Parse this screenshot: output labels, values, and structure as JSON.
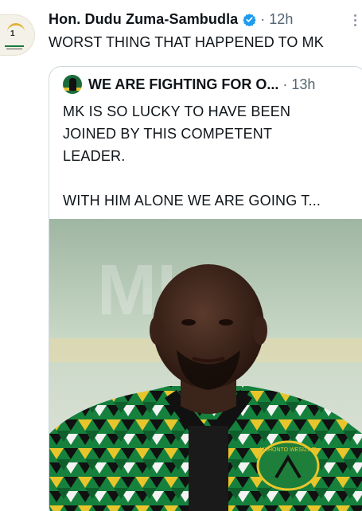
{
  "tweet": {
    "author": "Hon. Dudu Zuma-Sambudla",
    "separator": "·",
    "time": "12h",
    "text": "WORST THING THAT HAPPENED TO MK",
    "avatar_text": "1",
    "verified_color": "#1d9bf0"
  },
  "quote": {
    "author": "WE ARE FIGHTING FOR O...",
    "separator": "·",
    "time": "13h",
    "lines": [
      "MK IS SO LUCKY TO HAVE BEEN",
      "JOINED BY THIS COMPETENT",
      "LEADER.",
      "WITH HIM ALONE WE ARE GOING T..."
    ]
  },
  "photo": {
    "subject": "man in black, green and yellow patterned shirt",
    "shirt_badge_icon": "mk-party-logo"
  }
}
